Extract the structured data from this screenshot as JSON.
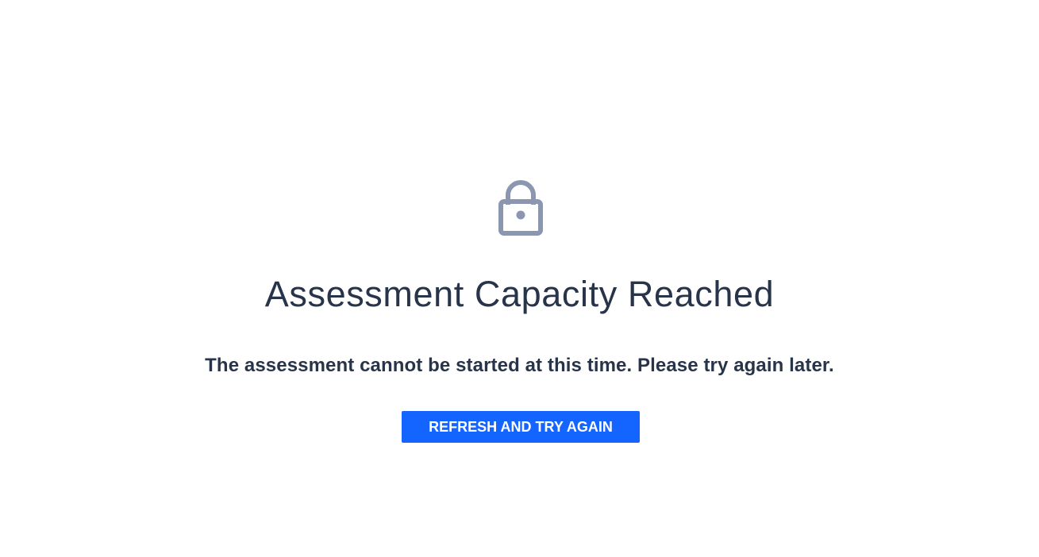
{
  "page": {
    "icon": "lock-icon",
    "title": "Assessment Capacity Reached",
    "message": "The assessment cannot be started at this time. Please try again later.",
    "button_label": "REFRESH AND TRY AGAIN"
  },
  "colors": {
    "background": "#ffffff",
    "text": "#27344a",
    "icon": "#8b97b1",
    "button_background": "#1464ff",
    "button_text": "#ffffff"
  }
}
